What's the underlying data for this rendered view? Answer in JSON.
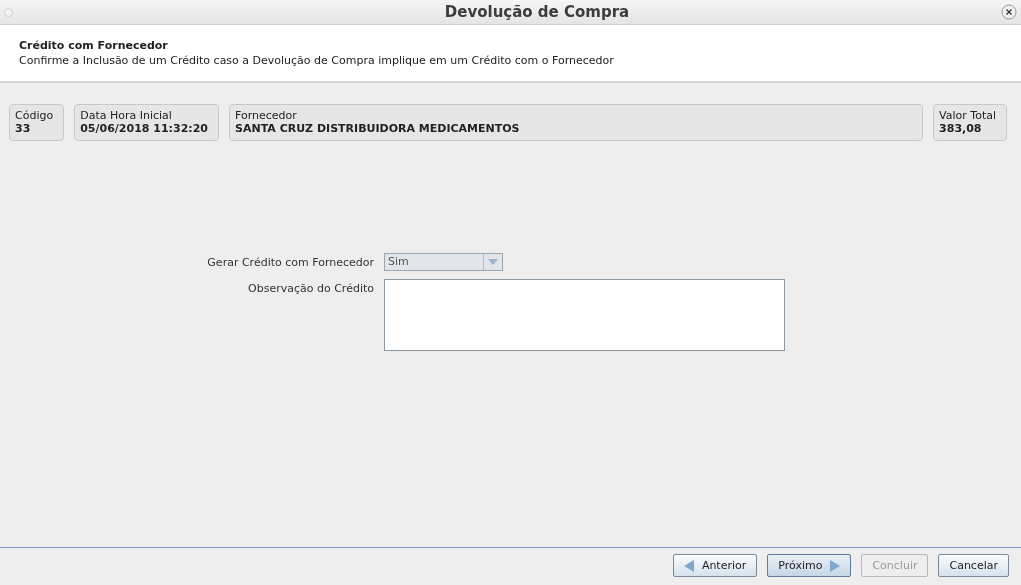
{
  "window": {
    "title": "Devolução de Compra"
  },
  "header": {
    "title": "Crédito com Fornecedor",
    "description": "Confirme a Inclusão de um Crédito caso a Devolução de Compra implique em um Crédito com o Fornecedor"
  },
  "info_boxes": [
    {
      "label": "Código",
      "value": "33",
      "grow": false
    },
    {
      "label": "Data Hora Inicial",
      "value": "05/06/2018 11:32:20",
      "grow": false
    },
    {
      "label": "Fornecedor",
      "value": "SANTA CRUZ DISTRIBUIDORA MEDICAMENTOS",
      "grow": true
    },
    {
      "label": "Valor Total",
      "value": "383,08",
      "grow": false
    }
  ],
  "form": {
    "fields": [
      {
        "kind": "combo",
        "label": "Gerar Crédito com Fornecedor",
        "value": "Sim"
      },
      {
        "kind": "textarea",
        "label": "Observação do Crédito"
      }
    ]
  },
  "buttons": [
    {
      "kind": "back",
      "label": "Anterior",
      "disabled": false,
      "selected": false
    },
    {
      "kind": "next",
      "label": "Próximo",
      "disabled": false,
      "selected": true
    },
    {
      "kind": "plain",
      "label": "Concluir",
      "disabled": true,
      "selected": false
    },
    {
      "kind": "plain",
      "label": "Cancelar",
      "disabled": false,
      "selected": false
    }
  ]
}
